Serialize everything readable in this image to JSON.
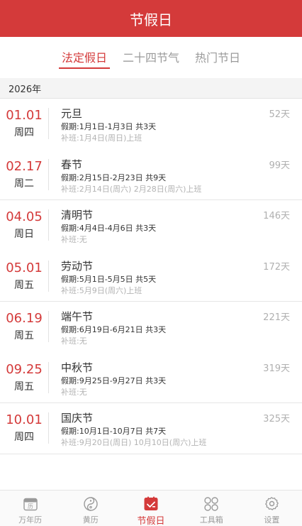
{
  "header": {
    "title": "节假日"
  },
  "tabs": [
    {
      "label": "法定假日",
      "active": true
    },
    {
      "label": "二十四节气",
      "active": false
    },
    {
      "label": "热门节日",
      "active": false
    }
  ],
  "year": "2026年",
  "holidays": [
    {
      "date": "01.01",
      "weekday": "周四",
      "name": "元旦",
      "days": "52天",
      "holiday_label": "假期:",
      "holiday_text": "1月1日-1月3日 共3天",
      "workday_label": "补班:",
      "workday_text": "1月4日(周日)上班"
    },
    {
      "date": "02.17",
      "weekday": "周二",
      "name": "春节",
      "days": "99天",
      "holiday_label": "假期:",
      "holiday_text": "2月15日-2月23日 共9天",
      "workday_label": "补班:",
      "workday_text": "2月14日(周六) 2月28日(周六)上班"
    },
    {
      "date": "04.05",
      "weekday": "周日",
      "name": "清明节",
      "days": "146天",
      "holiday_label": "假期:",
      "holiday_text": "4月4日-4月6日 共3天",
      "workday_label": "补班:",
      "workday_text": "无"
    },
    {
      "date": "05.01",
      "weekday": "周五",
      "name": "劳动节",
      "days": "172天",
      "holiday_label": "假期:",
      "holiday_text": "5月1日-5月5日 共5天",
      "workday_label": "补班:",
      "workday_text": "5月9日(周六)上班"
    },
    {
      "date": "06.19",
      "weekday": "周五",
      "name": "端午节",
      "days": "221天",
      "holiday_label": "假期:",
      "holiday_text": "6月19日-6月21日 共3天",
      "workday_label": "补班:",
      "workday_text": "无"
    },
    {
      "date": "09.25",
      "weekday": "周五",
      "name": "中秋节",
      "days": "319天",
      "holiday_label": "假期:",
      "holiday_text": "9月25日-9月27日 共3天",
      "workday_label": "补班:",
      "workday_text": "无"
    },
    {
      "date": "10.01",
      "weekday": "周四",
      "name": "国庆节",
      "days": "325天",
      "holiday_label": "假期:",
      "holiday_text": "10月1日-10月7日 共7天",
      "workday_label": "补班:",
      "workday_text": "9月20日(周日) 10月10日(周六)上班"
    }
  ],
  "bottom_nav": [
    {
      "label": "万年历",
      "icon": "calendar-icon",
      "active": false
    },
    {
      "label": "黄历",
      "icon": "yin-yang-icon",
      "active": false
    },
    {
      "label": "节假日",
      "icon": "holiday-check-icon",
      "active": true
    },
    {
      "label": "工具箱",
      "icon": "grid-icon",
      "active": false
    },
    {
      "label": "设置",
      "icon": "gear-icon",
      "active": false
    }
  ],
  "colors": {
    "accent": "#d43a3a",
    "muted": "#9a9a9a",
    "divider": "#e6e6e6"
  },
  "calendar_icon_glyph": "历"
}
